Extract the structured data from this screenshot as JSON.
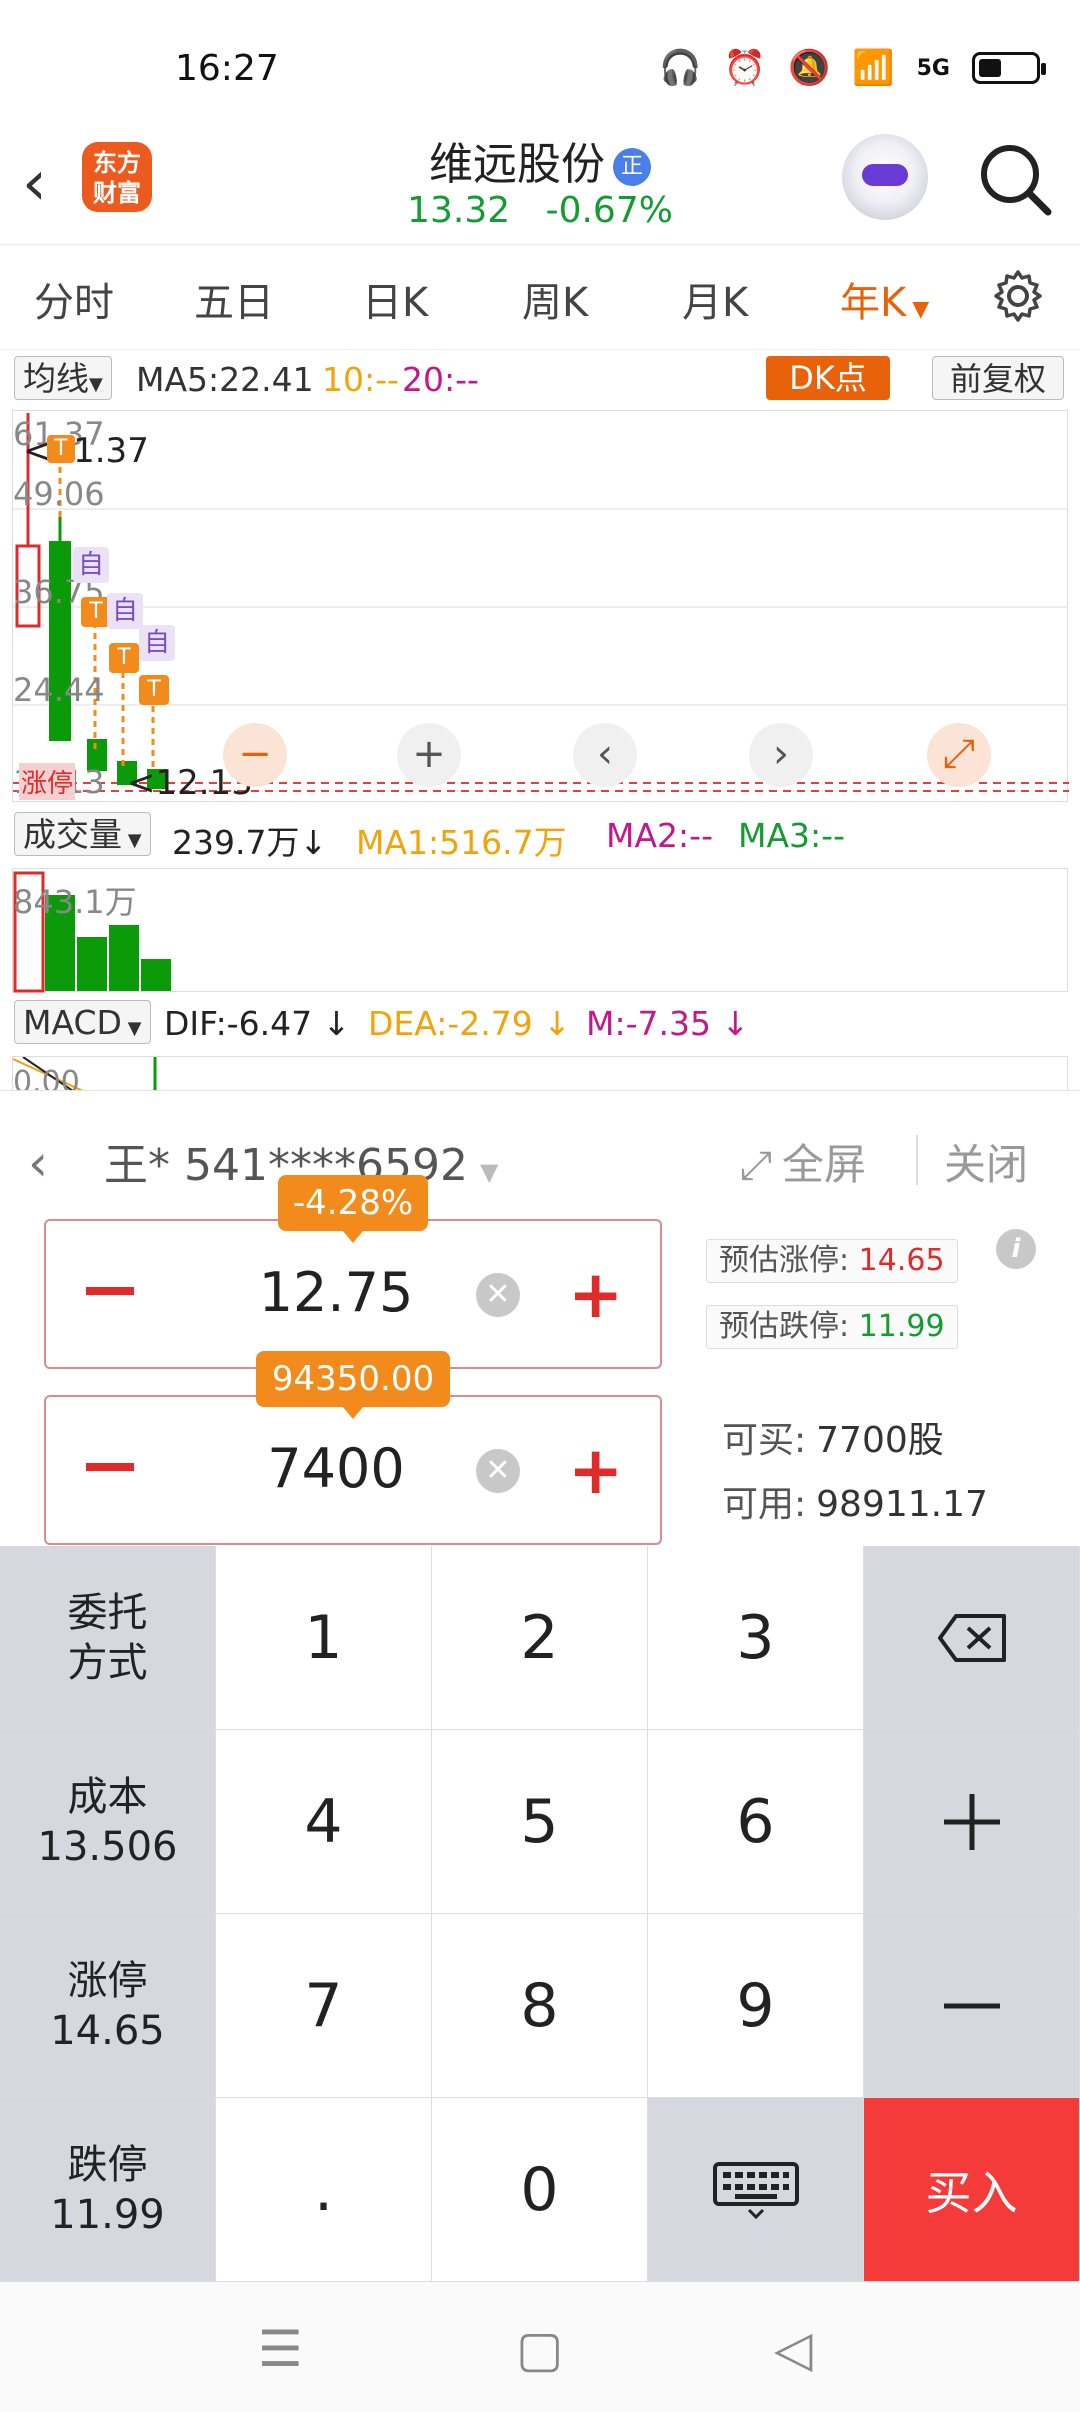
{
  "status": {
    "time": "16:27",
    "network": "5G"
  },
  "header": {
    "logo_text": "东方财富",
    "stock_name": "维远股份",
    "stock_badge": "正",
    "price": "13.32",
    "change": "-0.67%"
  },
  "tabs": [
    "分时",
    "五日",
    "日K",
    "周K",
    "月K",
    "年K"
  ],
  "active_tab": "年K",
  "ma_row": {
    "selector": "均线",
    "ma5": "MA5:22.41",
    "ma10": "10:--",
    "ma20": "20:--",
    "dk": "DK点",
    "fq": "前复权"
  },
  "price_chart": {
    "axis_labels": [
      "61.37",
      "49.06",
      "36.75",
      "24.44",
      "12.13"
    ],
    "high_marker": "<61.37",
    "low_marker": "<12.13",
    "tags": [
      "T",
      "自",
      "T",
      "自",
      "T",
      "自",
      "T"
    ],
    "overlay_text": "涨停"
  },
  "vol_row": {
    "selector": "成交量",
    "value": "239.7万",
    "ma1": "MA1:516.7万",
    "ma2": "MA2:--",
    "ma3": "MA3:--",
    "axis_label": "843.1万"
  },
  "macd_row": {
    "selector": "MACD",
    "dif": "DIF:-6.47",
    "dea": "DEA:-2.79",
    "m": "M:-7.35",
    "axis_label": "0.00"
  },
  "arrows": {
    "down": "↓"
  },
  "controls": [
    "−",
    "+",
    "‹",
    "›",
    "⤢"
  ],
  "panel": {
    "account": "王* 541****6592",
    "fullscreen": "全屏",
    "close": "关闭",
    "price_pct": "-4.28%",
    "price_value": "12.75",
    "amount_bubble": "94350.00",
    "qty_value": "7400",
    "est_up_label": "预估涨停:",
    "est_up_value": "14.65",
    "est_down_label": "预估跌停:",
    "est_down_value": "11.99",
    "can_buy_label": "可买:",
    "can_buy_value": "7700股",
    "can_use_label": "可用:",
    "can_use_value": "98911.17"
  },
  "keypad": {
    "side": [
      {
        "line1": "委托",
        "line2": "方式"
      },
      {
        "line1": "成本",
        "line2": "13.506"
      },
      {
        "line1": "涨停",
        "line2": "14.65"
      },
      {
        "line1": "跌停",
        "line2": "11.99"
      }
    ],
    "digits": [
      "1",
      "2",
      "3",
      "4",
      "5",
      "6",
      "7",
      "8",
      "9",
      ".",
      "0"
    ],
    "buy": "买入"
  },
  "colors": {
    "accent": "#e8620b",
    "up": "#e02b2b",
    "down": "#139c32",
    "buy": "#f53a3a"
  }
}
